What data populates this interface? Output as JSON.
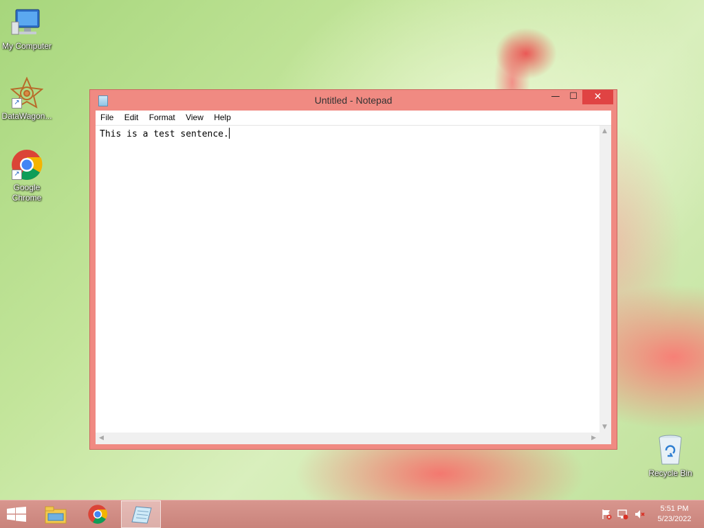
{
  "desktop": {
    "icons": [
      {
        "label": "My Computer",
        "icon": "computer-icon"
      },
      {
        "label": "DataWagon...",
        "icon": "datawagon-icon"
      },
      {
        "label": "Google Chrome",
        "icon": "chrome-icon"
      },
      {
        "label": "Recycle Bin",
        "icon": "recycle-bin-icon"
      }
    ]
  },
  "window": {
    "title": "Untitled - Notepad",
    "controls": {
      "minimize": "—",
      "maximize": "☐",
      "close": "✕"
    },
    "menu": [
      "File",
      "Edit",
      "Format",
      "View",
      "Help"
    ],
    "content": "This is a test sentence."
  },
  "taskbar": {
    "items": [
      "start-icon",
      "file-explorer-icon",
      "chrome-icon",
      "notepad-icon"
    ],
    "tray": [
      "flag-icon",
      "network-icon",
      "volume-muted-icon"
    ],
    "time": "5:51 PM",
    "date": "5/23/2022"
  },
  "colors": {
    "window_frame": "#f08a82",
    "close_button": "#e04343",
    "taskbar": "#c9837b"
  }
}
